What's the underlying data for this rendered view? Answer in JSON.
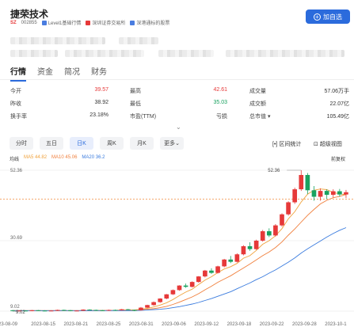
{
  "header": {
    "name": "捷荣技术",
    "market": "SZ",
    "code": "002855",
    "tags": [
      {
        "label": "Level1基础行情",
        "color": "#4a7de0"
      },
      {
        "label": "深圳证券交易所",
        "color": "#e63939"
      },
      {
        "label": "深港通标的股票",
        "color": "#4a7de0"
      }
    ],
    "add_label": "加自选"
  },
  "tabs": [
    "行情",
    "资金",
    "简况",
    "财务"
  ],
  "quote": {
    "rows": [
      [
        {
          "label": "今开",
          "value": "39.57",
          "color": "red"
        },
        {
          "label": "最高",
          "value": "42.61",
          "color": "red"
        },
        {
          "label": "成交量",
          "value": "57.06万手",
          "color": "dark"
        }
      ],
      [
        {
          "label": "昨收",
          "value": "38.92",
          "color": "dark"
        },
        {
          "label": "最低",
          "value": "35.03",
          "color": "green"
        },
        {
          "label": "成交额",
          "value": "22.07亿",
          "color": "dark"
        }
      ],
      [
        {
          "label": "换手率",
          "value": "23.18%",
          "color": "dark"
        },
        {
          "label": "市盈(TTM)",
          "value": "亏损",
          "color": "dark"
        },
        {
          "label": "总市值",
          "value": "105.49亿",
          "color": "dark"
        }
      ]
    ]
  },
  "periods": [
    "分时",
    "五日",
    "日K",
    "周K",
    "月K",
    "更多"
  ],
  "active_period": "日K",
  "tools": {
    "interval": "区间统计",
    "super": "超级视图",
    "restore": "前复权"
  },
  "ma": {
    "label": "均线",
    "items": [
      {
        "text": "MA5 44.82",
        "color": "#f0a23c"
      },
      {
        "text": "MA10 45.06",
        "color": "#f07f3c"
      },
      {
        "text": "MA20 36.2",
        "color": "#3a7bde"
      }
    ]
  },
  "chart_data": {
    "type": "candlestick",
    "y_labels": [
      "52.36",
      "30.69",
      "9.02"
    ],
    "ylim": [
      9.02,
      52.36
    ],
    "ref_line": 43.5,
    "high_label": "52.36",
    "low_label": "9.02",
    "x_labels": [
      "23-08-09",
      "2023-08-15",
      "2023-08-21",
      "2023-08-25",
      "2023-08-31",
      "2023-09-06",
      "2023-09-12",
      "2023-09-18",
      "2023-09-22",
      "2023-09-28",
      "2023-10-1"
    ],
    "candles": [
      [
        9.3,
        9.1,
        9.4,
        9.0
      ],
      [
        9.1,
        9.2,
        9.3,
        9.0
      ],
      [
        9.2,
        9.1,
        9.3,
        9.0
      ],
      [
        9.1,
        9.3,
        9.4,
        9.0
      ],
      [
        9.3,
        9.2,
        9.4,
        9.1
      ],
      [
        9.2,
        9.1,
        9.3,
        9.0
      ],
      [
        9.1,
        9.2,
        9.3,
        9.0
      ],
      [
        9.2,
        9.4,
        9.5,
        9.1
      ],
      [
        9.4,
        9.3,
        9.5,
        9.2
      ],
      [
        9.3,
        9.1,
        9.4,
        9.0
      ],
      [
        9.1,
        9.2,
        9.3,
        9.0
      ],
      [
        9.2,
        9.5,
        9.6,
        9.1
      ],
      [
        9.5,
        9.4,
        9.6,
        9.3
      ],
      [
        9.4,
        9.3,
        9.5,
        9.2
      ],
      [
        9.3,
        9.2,
        9.4,
        9.1
      ],
      [
        9.2,
        9.4,
        9.5,
        9.1
      ],
      [
        9.4,
        9.3,
        9.5,
        9.2
      ],
      [
        9.3,
        9.6,
        9.7,
        9.2
      ],
      [
        9.6,
        9.4,
        9.7,
        9.3
      ],
      [
        9.4,
        9.3,
        9.5,
        9.02
      ],
      [
        9.3,
        10.1,
        10.3,
        9.2
      ],
      [
        10.1,
        10.9,
        11.0,
        10.0
      ],
      [
        10.9,
        11.8,
        12.0,
        10.7
      ],
      [
        11.8,
        12.9,
        13.0,
        11.6
      ],
      [
        12.9,
        14.2,
        14.3,
        12.7
      ],
      [
        14.2,
        15.5,
        15.7,
        14.0
      ],
      [
        15.5,
        16.9,
        17.0,
        15.3
      ],
      [
        16.9,
        16.5,
        17.5,
        16.2
      ],
      [
        16.5,
        18.0,
        18.2,
        16.3
      ],
      [
        18.0,
        19.7,
        19.8,
        17.8
      ],
      [
        19.7,
        21.5,
        21.7,
        19.4
      ],
      [
        21.5,
        20.8,
        22.2,
        20.5
      ],
      [
        20.8,
        22.8,
        23.0,
        20.6
      ],
      [
        22.8,
        24.9,
        25.1,
        22.5
      ],
      [
        24.9,
        24.2,
        26.0,
        23.8
      ],
      [
        24.2,
        26.5,
        26.8,
        24.0
      ],
      [
        26.5,
        29.0,
        29.3,
        26.2
      ],
      [
        29.0,
        28.1,
        30.2,
        27.6
      ],
      [
        28.1,
        30.7,
        31.0,
        27.9
      ],
      [
        30.7,
        33.6,
        34.0,
        30.4
      ],
      [
        33.6,
        32.3,
        34.5,
        31.8
      ],
      [
        32.3,
        35.4,
        35.8,
        32.0
      ],
      [
        35.4,
        38.8,
        39.1,
        35.0
      ],
      [
        38.8,
        42.5,
        42.8,
        38.4
      ],
      [
        42.5,
        46.5,
        47.0,
        42.0
      ],
      [
        46.5,
        50.9,
        52.36,
        46.0
      ],
      [
        50.9,
        46.2,
        51.5,
        45.0
      ],
      [
        46.2,
        44.2,
        47.5,
        43.0
      ],
      [
        44.2,
        46.0,
        46.8,
        43.0
      ],
      [
        46.0,
        44.8,
        46.5,
        43.5
      ],
      [
        44.8,
        45.9,
        46.5,
        44.0
      ],
      [
        45.9,
        44.9,
        46.6,
        44.2
      ],
      [
        44.9,
        45.6,
        46.3,
        43.8
      ]
    ],
    "ma_series": [
      {
        "name": "MA5",
        "color": "#f0a23c",
        "values": [
          9.2,
          9.2,
          9.2,
          9.2,
          9.2,
          9.2,
          9.2,
          9.2,
          9.2,
          9.2,
          9.2,
          9.2,
          9.3,
          9.3,
          9.3,
          9.3,
          9.3,
          9.4,
          9.4,
          9.4,
          9.6,
          9.9,
          10.3,
          10.9,
          11.6,
          12.6,
          13.8,
          14.9,
          15.8,
          17.2,
          18.6,
          19.6,
          20.9,
          22.0,
          22.7,
          23.7,
          25.3,
          26.1,
          27.7,
          29.6,
          30.7,
          32.2,
          34.4,
          37.4,
          39.6,
          42.6,
          45.0,
          46.2,
          46.6,
          46.4,
          45.5,
          45.1,
          44.8
        ]
      },
      {
        "name": "MA10",
        "color": "#f07f3c",
        "values": [
          9.2,
          9.2,
          9.2,
          9.2,
          9.2,
          9.2,
          9.2,
          9.2,
          9.2,
          9.2,
          9.2,
          9.2,
          9.2,
          9.2,
          9.2,
          9.3,
          9.3,
          9.3,
          9.3,
          9.3,
          9.4,
          9.6,
          9.8,
          10.1,
          10.5,
          11.1,
          11.8,
          12.6,
          13.4,
          14.4,
          15.6,
          16.7,
          17.9,
          18.9,
          19.9,
          21.1,
          22.3,
          23.5,
          24.8,
          26.1,
          27.2,
          28.6,
          30.3,
          32.4,
          34.3,
          36.4,
          38.5,
          40.3,
          42.0,
          43.1,
          43.9,
          44.3,
          44.9
        ]
      },
      {
        "name": "MA20",
        "color": "#3a7bde",
        "values": [
          9.2,
          9.2,
          9.2,
          9.2,
          9.2,
          9.2,
          9.2,
          9.2,
          9.2,
          9.2,
          9.2,
          9.2,
          9.2,
          9.2,
          9.2,
          9.2,
          9.2,
          9.2,
          9.2,
          9.2,
          9.3,
          9.4,
          9.5,
          9.6,
          9.8,
          10.1,
          10.4,
          10.8,
          11.2,
          11.7,
          12.3,
          12.9,
          13.6,
          14.3,
          15.0,
          15.9,
          16.8,
          17.7,
          18.7,
          19.6,
          20.7,
          21.7,
          22.9,
          24.1,
          25.4,
          26.9,
          28.2,
          29.4,
          30.6,
          31.8,
          32.9,
          33.9,
          34.7
        ]
      }
    ]
  }
}
